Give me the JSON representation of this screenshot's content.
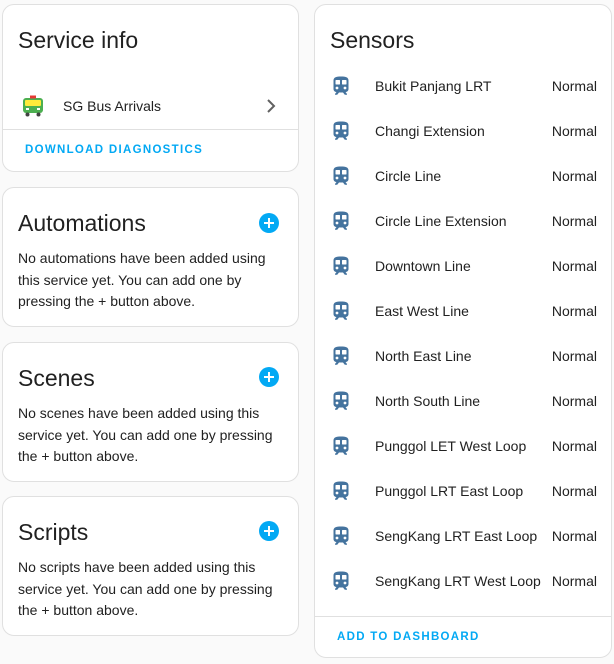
{
  "service_info": {
    "title": "Service info",
    "integration_name": "SG Bus Arrivals",
    "download_label": "DOWNLOAD DIAGNOSTICS"
  },
  "automations": {
    "title": "Automations",
    "description": "No automations have been added using this service yet. You can add one by pressing the + button above."
  },
  "scenes": {
    "title": "Scenes",
    "description": "No scenes have been added using this service yet. You can add one by pressing the + button above."
  },
  "scripts": {
    "title": "Scripts",
    "description": "No scripts have been added using this service yet. You can add one by pressing the + button above."
  },
  "sensors": {
    "title": "Sensors",
    "items": [
      {
        "name": "Bukit Panjang LRT",
        "state": "Normal",
        "icon": "train-icon"
      },
      {
        "name": "Changi Extension",
        "state": "Normal",
        "icon": "train-icon"
      },
      {
        "name": "Circle Line",
        "state": "Normal",
        "icon": "train-icon"
      },
      {
        "name": "Circle Line Extension",
        "state": "Normal",
        "icon": "train-icon"
      },
      {
        "name": "Downtown Line",
        "state": "Normal",
        "icon": "train-icon"
      },
      {
        "name": "East West Line",
        "state": "Normal",
        "icon": "train-icon"
      },
      {
        "name": "North East Line",
        "state": "Normal",
        "icon": "train-icon"
      },
      {
        "name": "North South Line",
        "state": "Normal",
        "icon": "train-icon"
      },
      {
        "name": "Punggol LET West Loop",
        "state": "Normal",
        "icon": "train-icon"
      },
      {
        "name": "Punggol LRT East Loop",
        "state": "Normal",
        "icon": "train-icon"
      },
      {
        "name": "SengKang LRT East Loop",
        "state": "Normal",
        "icon": "train-icon"
      },
      {
        "name": "SengKang LRT West Loop",
        "state": "Normal",
        "icon": "train-icon"
      }
    ],
    "add_to_dashboard_label": "ADD TO DASHBOARD"
  },
  "colors": {
    "accent": "#03a9f4",
    "icon": "#44739e",
    "card_border": "#e0e0e0"
  }
}
